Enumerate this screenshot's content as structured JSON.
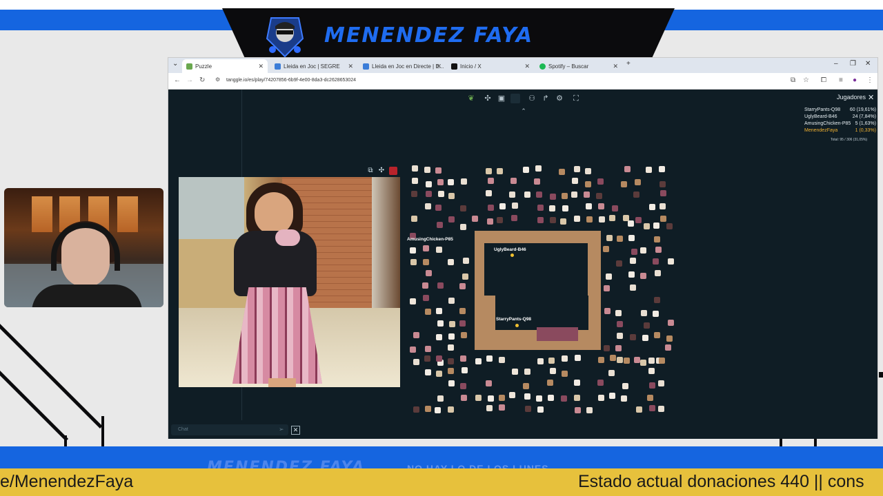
{
  "overlay": {
    "streamer_name": "MENENDEZ FAYA",
    "bottom_faded_name": "MENENDEZ FAYA",
    "bottom_faded_text": "NO HAY LO DE LOS LUNES",
    "ticker_left": "e/MenendezFaya",
    "ticker_right": "Estado actual donaciones 440 || cons",
    "colors": {
      "band": "#1565e0",
      "ticker": "#e7c13c",
      "banner": "#0b0b0d"
    }
  },
  "browser": {
    "tabs": [
      {
        "label": "Puzzle",
        "icon": "puzzle-leaf-icon",
        "active": true
      },
      {
        "label": "Lleida en Joc | SEGRE",
        "icon": "segre-icon",
        "active": false
      },
      {
        "label": "Lleida en Joc en Directe | E...",
        "icon": "segre-icon",
        "active": false
      },
      {
        "label": "Inicio / X",
        "icon": "x-icon",
        "active": false
      },
      {
        "label": "Spotify – Buscar",
        "icon": "spotify-icon",
        "active": false
      }
    ],
    "url": "tanggle.io/es/play/74207856-6b9f-4e00-8da3-dc2628653024"
  },
  "game": {
    "players_title": "Jugadores",
    "players": [
      {
        "name": "StarryPants-Q98",
        "score": "60 (19,61%)",
        "me": false
      },
      {
        "name": "UglyBeard-B46",
        "score": "24 (7,84%)",
        "me": false
      },
      {
        "name": "AmusingChicken-P85",
        "score": "5 (1,63%)",
        "me": false
      },
      {
        "name": "MenendezFaya",
        "score": "1 (0,33%)",
        "me": true
      }
    ],
    "total": "Total: 95 / 306 (31,05%)",
    "cursors": [
      "AmusingChicken-P85",
      "UglyBeard-B46",
      "StarryPants-Q98"
    ],
    "chat_placeholder": "Chat"
  }
}
